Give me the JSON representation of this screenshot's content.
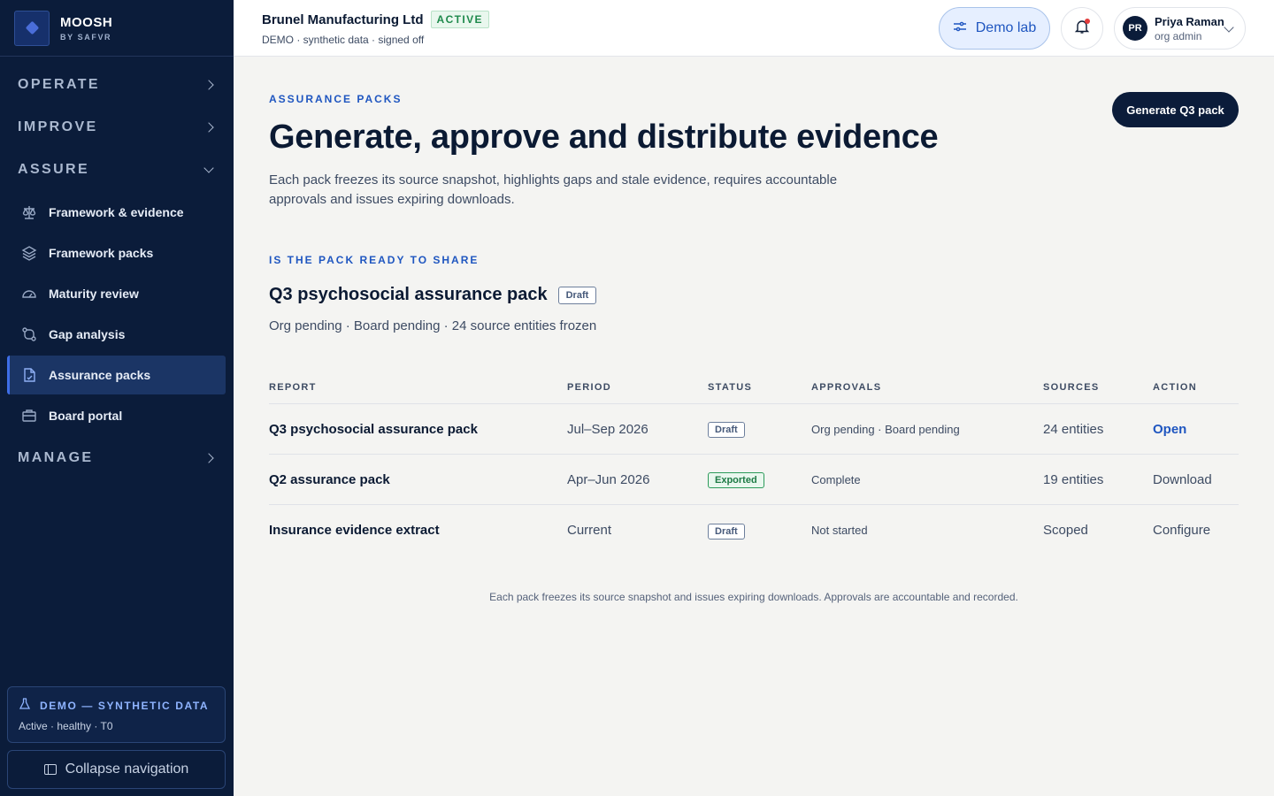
{
  "brand": {
    "name": "MOOSH",
    "sub": "BY SAFVR"
  },
  "sidebar": {
    "sections": {
      "operate": "OPERATE",
      "improve": "IMPROVE",
      "assure": "ASSURE",
      "manage": "MANAGE"
    },
    "items": [
      {
        "label": "Framework & evidence",
        "icon": "scale-icon"
      },
      {
        "label": "Framework packs",
        "icon": "layers-icon"
      },
      {
        "label": "Maturity review",
        "icon": "gauge-icon"
      },
      {
        "label": "Gap analysis",
        "icon": "git-compare-icon"
      },
      {
        "label": "Assurance packs",
        "icon": "file-icon",
        "active": true
      },
      {
        "label": "Board portal",
        "icon": "briefcase-icon"
      }
    ],
    "demo": {
      "title": "DEMO — SYNTHETIC DATA",
      "sub": "Active · healthy · T0"
    },
    "collapse_label": "Collapse navigation"
  },
  "topbar": {
    "org_name": "Brunel Manufacturing Ltd",
    "status": "ACTIVE",
    "org_sub": "DEMO · synthetic data · signed off",
    "demo_lab": "Demo lab",
    "user": {
      "initials": "PR",
      "name": "Priya Raman",
      "role": "org admin"
    }
  },
  "main": {
    "eyebrow": "ASSURANCE PACKS",
    "title": "Generate, approve and distribute evidence",
    "lead": "Each pack freezes its source snapshot, highlights gaps and stale evidence, requires accountable approvals and issues expiring downloads.",
    "generate_button": "Generate Q3 pack",
    "readiness_eyebrow": "IS THE PACK READY TO SHARE",
    "pack_title": "Q3 psychosocial assurance pack",
    "pack_status": "Draft",
    "pack_sub": "Org pending · Board pending · 24 source entities frozen",
    "table": {
      "headers": [
        "REPORT",
        "PERIOD",
        "STATUS",
        "APPROVALS",
        "SOURCES",
        "ACTION"
      ],
      "rows": [
        {
          "report": "Q3 psychosocial assurance pack",
          "period": "Jul–Sep 2026",
          "status": "Draft",
          "approvals": "Org pending · Board pending",
          "sources": "24 entities",
          "action": "Open"
        },
        {
          "report": "Q2 assurance pack",
          "period": "Apr–Jun 2026",
          "status": "Exported",
          "approvals": "Complete",
          "sources": "19 entities",
          "action": "Download"
        },
        {
          "report": "Insurance evidence extract",
          "period": "Current",
          "status": "Draft",
          "approvals": "Not started",
          "sources": "Scoped",
          "action": "Configure"
        }
      ]
    },
    "footnote": "Each pack freezes its source snapshot and issues expiring downloads. Approvals are accountable and recorded."
  },
  "colors": {
    "sidebar_bg": "#0b1c3a",
    "accent": "#1f56c0",
    "success": "#1d7a44",
    "alert": "#e23b3b"
  }
}
